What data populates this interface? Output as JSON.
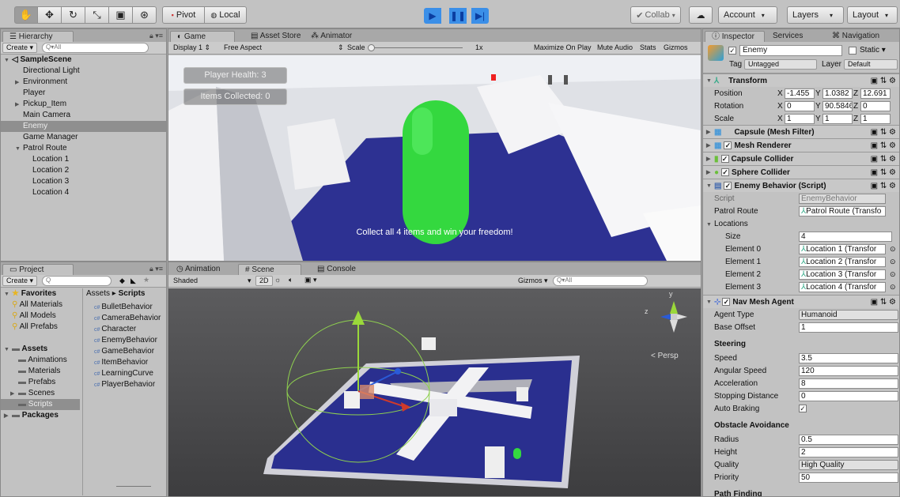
{
  "toolbar": {
    "tools": [
      "hand-icon",
      "move-icon",
      "rotate-icon",
      "scale-icon",
      "rect-icon",
      "transform-icon"
    ],
    "tool_glyphs": [
      "✋",
      "✥",
      "↻",
      "⤡",
      "▣",
      "⊛"
    ],
    "pivot": "Pivot",
    "local": "Local",
    "collab": "Collab",
    "account": "Account",
    "layers": "Layers",
    "layout": "Layout"
  },
  "hierarchy": {
    "tab": "Hierarchy",
    "create": "Create",
    "search_placeholder": "Q▾All",
    "scene": "SampleScene",
    "items": [
      {
        "label": "Directional Light",
        "indent": 1,
        "arrow": ""
      },
      {
        "label": "Environment",
        "indent": 1,
        "arrow": "▶"
      },
      {
        "label": "Player",
        "indent": 1,
        "arrow": ""
      },
      {
        "label": "Pickup_Item",
        "indent": 1,
        "arrow": "▶"
      },
      {
        "label": "Main Camera",
        "indent": 1,
        "arrow": ""
      },
      {
        "label": "Enemy",
        "indent": 1,
        "arrow": "",
        "selected": true
      },
      {
        "label": "Game Manager",
        "indent": 1,
        "arrow": ""
      },
      {
        "label": "Patrol Route",
        "indent": 1,
        "arrow": "▼"
      },
      {
        "label": "Location 1",
        "indent": 2,
        "arrow": ""
      },
      {
        "label": "Location 2",
        "indent": 2,
        "arrow": ""
      },
      {
        "label": "Location 3",
        "indent": 2,
        "arrow": ""
      },
      {
        "label": "Location 4",
        "indent": 2,
        "arrow": ""
      }
    ]
  },
  "game": {
    "tabs": [
      "Game",
      "Asset Store",
      "Animator"
    ],
    "display": "Display 1",
    "aspect": "Free Aspect",
    "scale_label": "Scale",
    "scale_value": "1x",
    "options": [
      "Maximize On Play",
      "Mute Audio",
      "Stats",
      "Gizmos"
    ],
    "hud_health": "Player Health: 3",
    "hud_items": "Items Collected: 0",
    "message": "Collect all 4 items and win your freedom!"
  },
  "project": {
    "tab": "Project",
    "create": "Create",
    "favorites_label": "Favorites",
    "favorites": [
      "All Materials",
      "All Models",
      "All Prefabs"
    ],
    "assets_label": "Assets",
    "asset_folders": [
      "Animations",
      "Materials",
      "Prefabs",
      "Scenes",
      "Scripts"
    ],
    "packages_label": "Packages",
    "breadcrumb_root": "Assets",
    "breadcrumb_leaf": "Scripts",
    "scripts": [
      "BulletBehavior",
      "CameraBehavior",
      "Character",
      "EnemyBehavior",
      "GameBehavior",
      "ItemBehavior",
      "LearningCurve",
      "PlayerBehavior"
    ]
  },
  "scene": {
    "tabs": [
      "Animation",
      "Scene",
      "Console"
    ],
    "shading": "Shaded",
    "mode_2d": "2D",
    "gizmos": "Gizmos",
    "search_placeholder": "Q▾All",
    "persp": "< Persp",
    "axis_y": "y",
    "axis_z": "z"
  },
  "inspector": {
    "tabs": [
      "Inspector",
      "Services",
      "Navigation"
    ],
    "object_name": "Enemy",
    "static_label": "Static",
    "tag_label": "Tag",
    "tag_value": "Untagged",
    "layer_label": "Layer",
    "layer_value": "Default",
    "transform": {
      "title": "Transform",
      "position_label": "Position",
      "position": [
        "-1.455",
        "1.0382",
        "12.691"
      ],
      "rotation_label": "Rotation",
      "rotation": [
        "0",
        "90.5846",
        "0"
      ],
      "scale_label": "Scale",
      "scale": [
        "1",
        "1",
        "1"
      ]
    },
    "components": [
      "Capsule (Mesh Filter)",
      "Mesh Renderer",
      "Capsule Collider",
      "Sphere Collider",
      "Enemy Behavior (Script)"
    ],
    "script_label": "Script",
    "script_value": "EnemyBehavior",
    "patrol_label": "Patrol Route",
    "patrol_value": "Patrol Route (Transfo",
    "locations_label": "Locations",
    "size_label": "Size",
    "size_value": "4",
    "elements": [
      {
        "label": "Element 0",
        "value": "Location 1 (Transfor"
      },
      {
        "label": "Element 1",
        "value": "Location 2 (Transfor"
      },
      {
        "label": "Element 2",
        "value": "Location 3 (Transfor"
      },
      {
        "label": "Element 3",
        "value": "Location 4 (Transfor"
      }
    ],
    "nav": {
      "title": "Nav Mesh Agent",
      "agent_type_label": "Agent Type",
      "agent_type": "Humanoid",
      "base_offset_label": "Base Offset",
      "base_offset": "1",
      "steering": "Steering",
      "speed_label": "Speed",
      "speed": "3.5",
      "angular_label": "Angular Speed",
      "angular": "120",
      "accel_label": "Acceleration",
      "accel": "8",
      "stopping_label": "Stopping Distance",
      "stopping": "0",
      "braking_label": "Auto Braking",
      "avoidance": "Obstacle Avoidance",
      "radius_label": "Radius",
      "radius": "0.5",
      "height_label": "Height",
      "height": "2",
      "quality_label": "Quality",
      "quality": "High Quality",
      "priority_label": "Priority",
      "priority": "50",
      "pathfinding": "Path Finding"
    }
  },
  "colors": {
    "enemy_green": "#34d83f",
    "floor_blue": "#2a2f8f",
    "play_blue": "#3b8fe8"
  }
}
